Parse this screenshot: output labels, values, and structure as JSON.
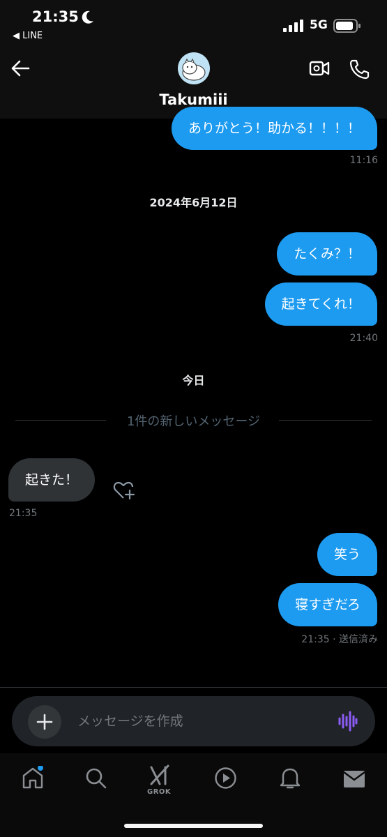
{
  "status_bar": {
    "time": "21:35",
    "back_app": "◀ LINE",
    "network": "5G"
  },
  "header": {
    "contact_name": "Takumiii"
  },
  "messages": {
    "m1": "ありがとう！助かる！！！！",
    "t1": "11:16",
    "date1": "2024年6月12日",
    "m2": "たくみ？！",
    "m3": "起きてくれ！",
    "t2": "21:40",
    "date2": "今日",
    "new_marker": "1件の新しいメッセージ",
    "m4": "起きた！",
    "t3": "21:35",
    "m5": "笑う",
    "m6": "寝すぎだろ",
    "t4": "21:35 · 送信済み"
  },
  "composer": {
    "placeholder": "メッセージを作成"
  },
  "nav": {
    "grok_label": "GROK"
  },
  "colors": {
    "accent": "#1d9bf0",
    "incoming": "#2f3336",
    "voice": "#8b5cf6"
  },
  "icons": [
    "moon-icon",
    "signal-icon",
    "battery-icon",
    "back-arrow-icon",
    "video-call-icon",
    "phone-icon",
    "heart-plus-icon",
    "plus-icon",
    "voice-icon",
    "home-icon",
    "search-icon",
    "grok-icon",
    "play-icon",
    "bell-icon",
    "mail-icon"
  ]
}
